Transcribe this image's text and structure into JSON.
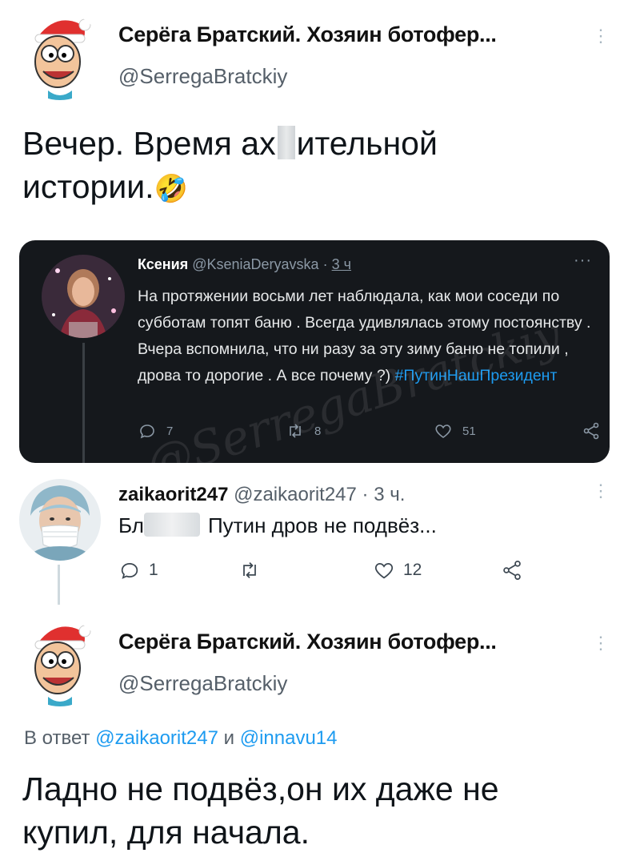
{
  "tweet": {
    "author": {
      "name": "Серёга Братский. Хозяин ботофер...",
      "handle": "@SerregaBratckiy"
    },
    "text_line1_a": "Вечер. Время ах",
    "text_line1_b": "ительной",
    "text_line2": "истории.",
    "emoji": "🤣"
  },
  "quoted": {
    "author_name": "Ксения",
    "author_handle": "@KseniaDeryavska",
    "time": "3 ч",
    "separator": "·",
    "menu": "···",
    "text": "На протяжении восьми лет наблюдала, как мои соседи по субботам топят баню . Всегда удивлялась этому постоянству . Вчера вспомнила, что ни разу за эту зиму баню не топили , дрова то дорогие . А все почему ?) ",
    "hashtag": "#ПутинНашПрезидент",
    "counts": {
      "replies": "7",
      "retweets": "8",
      "likes": "51"
    },
    "watermark": "@SerregaBratckiy"
  },
  "reply": {
    "author_name": "zaikaorit247",
    "author_handle": "@zaikaorit247",
    "separator": "·",
    "time": "3 ч.",
    "text_prefix": "Бл",
    "text": "Путин дров не подвёз...",
    "counts": {
      "replies": "1",
      "retweets": "",
      "likes": "12"
    }
  },
  "answer": {
    "author": {
      "name": "Серёга Братский. Хозяин ботофер...",
      "handle": "@SerregaBratckiy"
    },
    "reply_to_label": "В ответ",
    "reply_to_user1": "@zaikaorit247",
    "reply_to_and": "и",
    "reply_to_user2": "@innavu14",
    "text_line1": "Ладно не подвёз,он их даже не",
    "text_line2": "купил, для начала."
  },
  "colors": {
    "accent": "#1d9bf0",
    "dark_card": "#15181c"
  },
  "icons": [
    "more-vertical-icon",
    "reply-icon",
    "retweet-icon",
    "like-icon",
    "share-icon"
  ]
}
